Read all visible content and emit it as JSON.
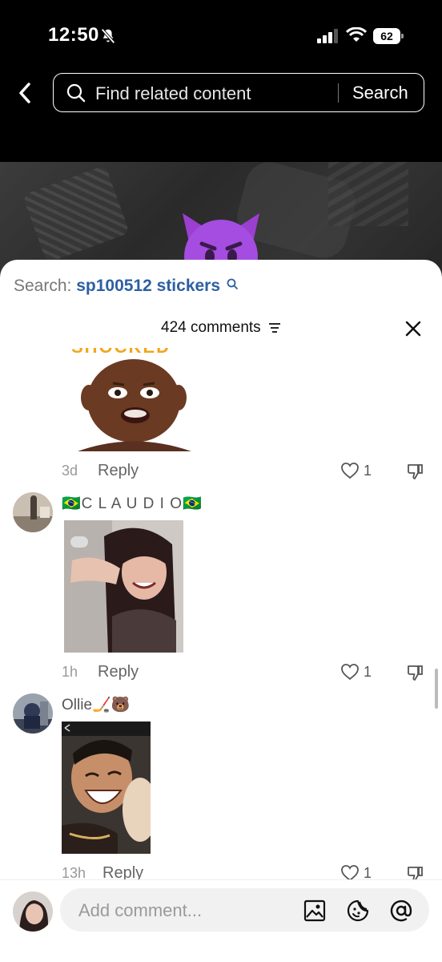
{
  "status_bar": {
    "time": "12:50",
    "battery": "62"
  },
  "nav": {
    "search_placeholder": "Find related content",
    "search_button": "Search"
  },
  "sheet": {
    "search_prefix": "Search:",
    "search_term": "sp100512 stickers",
    "comment_count": "424 comments"
  },
  "comments": [
    {
      "username": "",
      "time": "3d",
      "reply": "Reply",
      "likes": "1",
      "sticker_caption": "SHOCKED"
    },
    {
      "username": "🇧🇷C L A U D I O🇧🇷",
      "time": "1h",
      "reply": "Reply",
      "likes": "1"
    },
    {
      "username": "Ollie🏒🐻",
      "time": "13h",
      "reply": "Reply",
      "likes": "1"
    }
  ],
  "bottom_bar": {
    "placeholder": "Add comment..."
  },
  "colors": {
    "accent_link": "#2d5fa3",
    "sheet_bg": "#ffffff",
    "nav_bg": "#000000"
  },
  "icons": [
    "bell-slash-icon",
    "signal-icon",
    "wifi-icon",
    "battery-icon",
    "back-chevron-icon",
    "search-icon",
    "sort-icon",
    "close-icon",
    "heart-icon",
    "dislike-icon",
    "image-icon",
    "sticker-icon",
    "at-icon"
  ]
}
